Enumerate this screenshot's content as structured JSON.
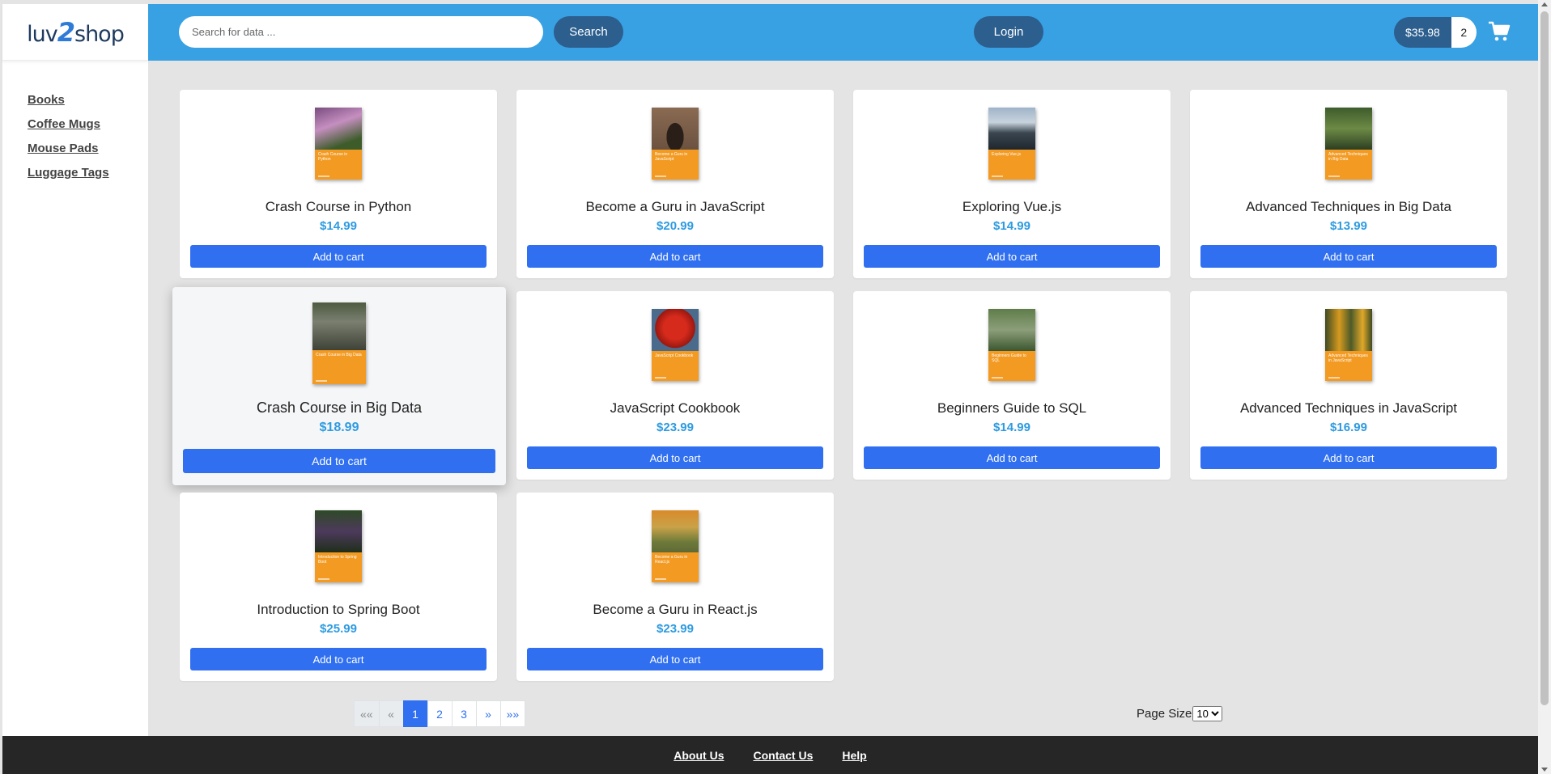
{
  "app": {
    "logo_text_a": "luv",
    "logo_text_b": "2",
    "logo_text_c": "shop"
  },
  "sidebar": {
    "items": [
      {
        "label": "Books"
      },
      {
        "label": "Coffee Mugs"
      },
      {
        "label": "Mouse Pads"
      },
      {
        "label": "Luggage Tags"
      }
    ]
  },
  "header": {
    "search_placeholder": "Search for data ...",
    "search_label": "Search",
    "login_label": "Login",
    "cart_total": "$35.98",
    "cart_quantity": "2",
    "cart_icon": "shopping-cart-icon"
  },
  "colors": {
    "header_bg": "#38a1e3",
    "dark_button": "#2c5e8e",
    "add_button": "#2f6ff0",
    "price": "#2e9be0",
    "footer_bg": "#262626",
    "book_cover": "#f39a22"
  },
  "products": [
    {
      "name": "Crash Course in Python",
      "price": "$14.99",
      "button": "Add to cart",
      "cover_title": "Crash Course in Python"
    },
    {
      "name": "Become a Guru in JavaScript",
      "price": "$20.99",
      "button": "Add to cart",
      "cover_title": "Become a Guru in JavaScript"
    },
    {
      "name": "Exploring Vue.js",
      "price": "$14.99",
      "button": "Add to cart",
      "cover_title": "Exploring Vue.js"
    },
    {
      "name": "Advanced Techniques in Big Data",
      "price": "$13.99",
      "button": "Add to cart",
      "cover_title": "Advanced Techniques in Big Data"
    },
    {
      "name": "Crash Course in Big Data",
      "price": "$18.99",
      "button": "Add to cart",
      "cover_title": "Crash Course in Big Data"
    },
    {
      "name": "JavaScript Cookbook",
      "price": "$23.99",
      "button": "Add to cart",
      "cover_title": "JavaScript Cookbook"
    },
    {
      "name": "Beginners Guide to SQL",
      "price": "$14.99",
      "button": "Add to cart",
      "cover_title": "Beginners Guide to SQL"
    },
    {
      "name": "Advanced Techniques in JavaScript",
      "price": "$16.99",
      "button": "Add to cart",
      "cover_title": "Advanced Techniques in JavaScript"
    },
    {
      "name": "Introduction to Spring Boot",
      "price": "$25.99",
      "button": "Add to cart",
      "cover_title": "Introduction to Spring Boot"
    },
    {
      "name": "Become a Guru in React.js",
      "price": "$23.99",
      "button": "Add to cart",
      "cover_title": "Become a Guru in React.js"
    }
  ],
  "pagination": {
    "first": "««",
    "prev": "«",
    "pages": [
      "1",
      "2",
      "3"
    ],
    "current_page": "1",
    "next": "»",
    "last": "»»",
    "page_size_label": "Page Size",
    "page_size_value": "10"
  },
  "footer": {
    "links": [
      "About Us",
      "Contact Us",
      "Help"
    ]
  }
}
